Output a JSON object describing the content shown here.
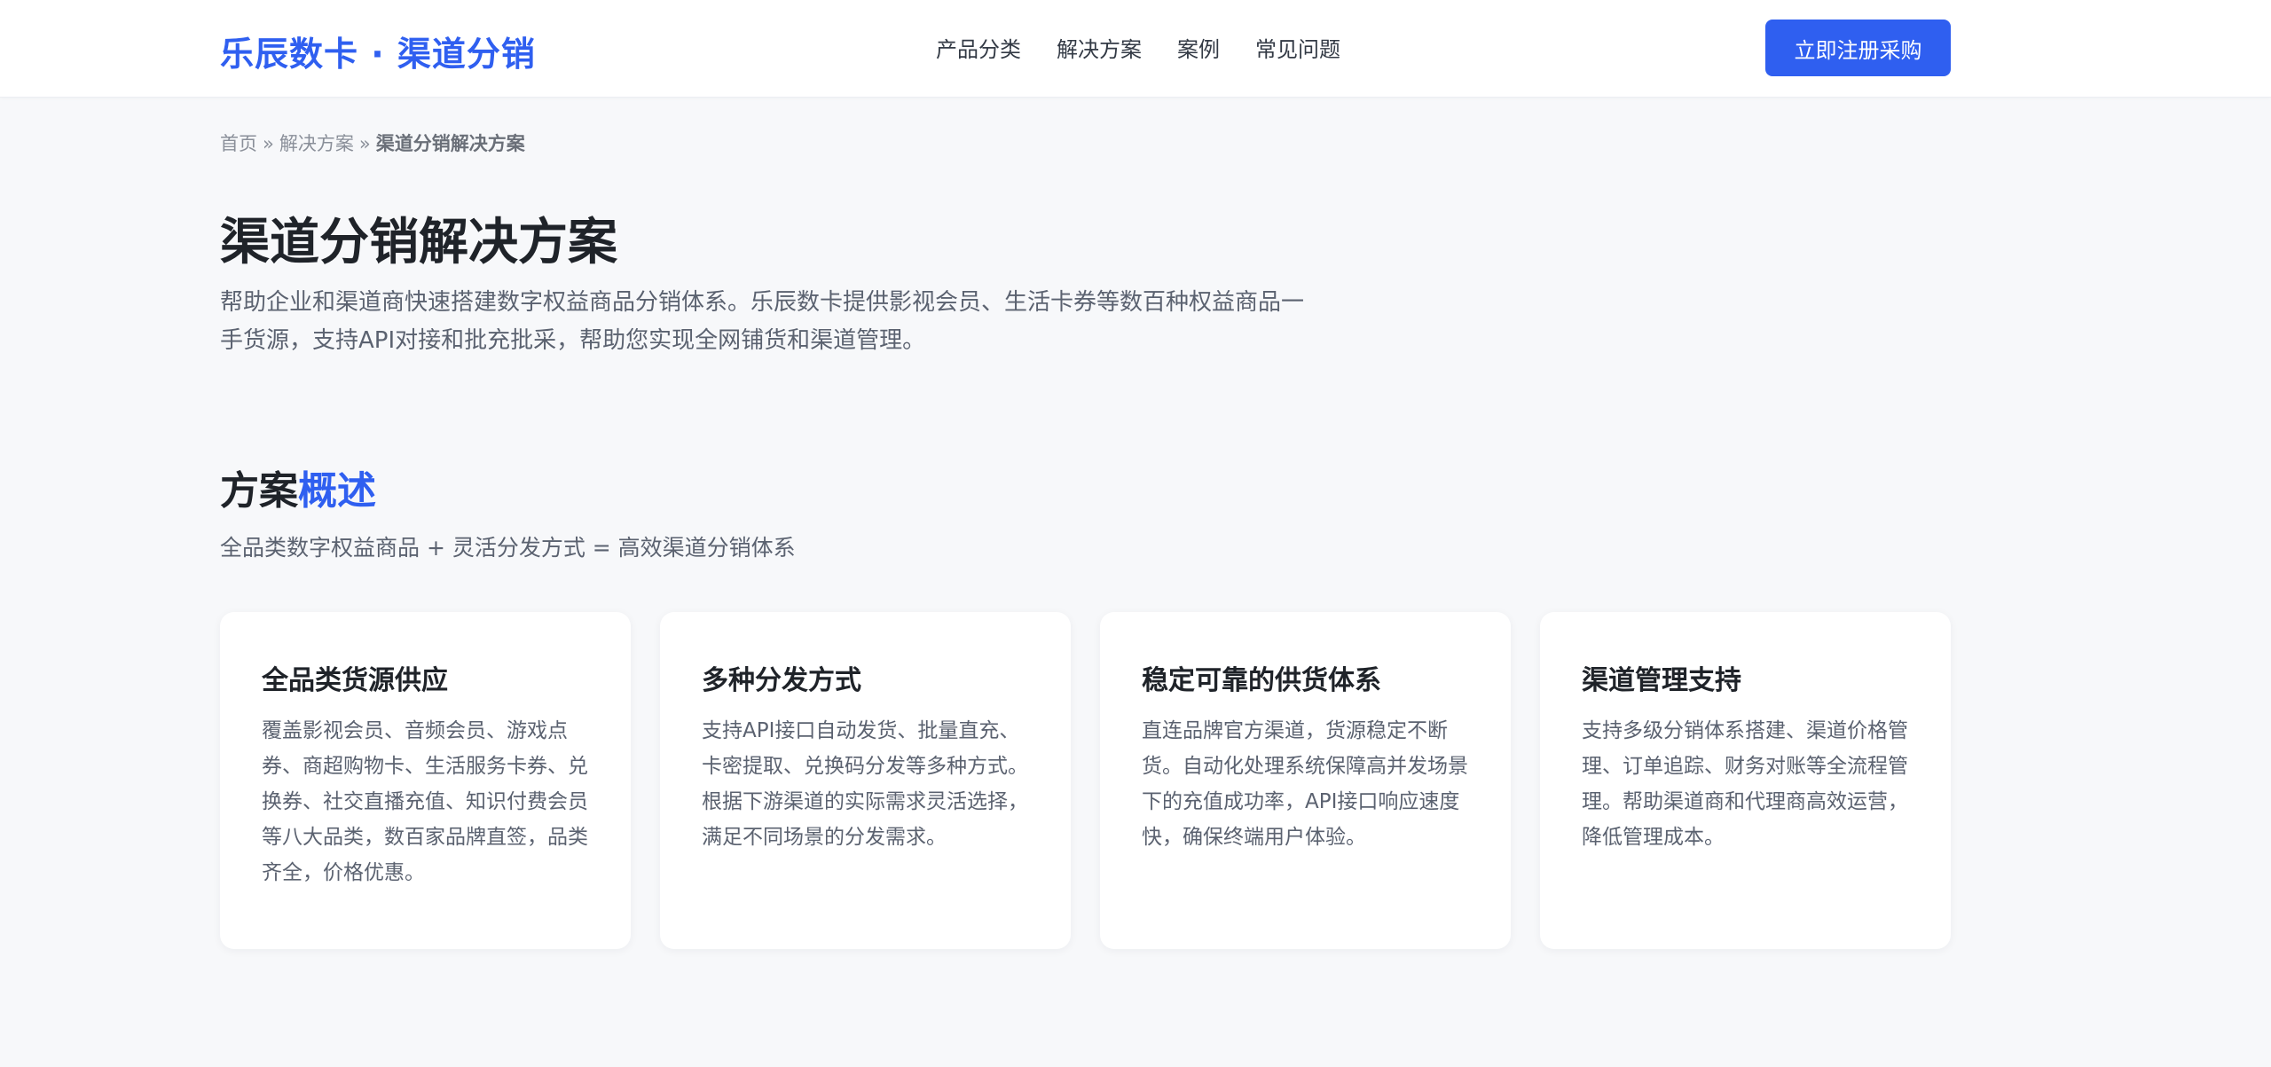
{
  "header": {
    "logo": "乐辰数卡 · 渠道分销",
    "nav": [
      "产品分类",
      "解决方案",
      "案例",
      "常见问题"
    ],
    "cta_label": "立即注册采购",
    "accent_color": "#2f5ff0"
  },
  "breadcrumb": {
    "items": [
      "首页",
      "解决方案"
    ],
    "separator": "»",
    "current": "渠道分销解决方案"
  },
  "hero": {
    "title": "渠道分销解决方案",
    "description": "帮助企业和渠道商快速搭建数字权益商品分销体系。乐辰数卡提供影视会员、生活卡券等数百种权益商品一手货源，支持API对接和批充批采，帮助您实现全网铺货和渠道管理。"
  },
  "overview": {
    "title_plain": "方案",
    "title_accent": "概述",
    "subtitle": "全品类数字权益商品 + 灵活分发方式 = 高效渠道分销体系",
    "cards": [
      {
        "title": "全品类货源供应",
        "body": "覆盖影视会员、音频会员、游戏点券、商超购物卡、生活服务卡券、兑换券、社交直播充值、知识付费会员等八大品类，数百家品牌直签，品类齐全，价格优惠。"
      },
      {
        "title": "多种分发方式",
        "body": "支持API接口自动发货、批量直充、卡密提取、兑换码分发等多种方式。根据下游渠道的实际需求灵活选择，满足不同场景的分发需求。"
      },
      {
        "title": "稳定可靠的供货体系",
        "body": "直连品牌官方渠道，货源稳定不断货。自动化处理系统保障高并发场景下的充值成功率，API接口响应速度快，确保终端用户体验。"
      },
      {
        "title": "渠道管理支持",
        "body": "支持多级分销体系搭建、渠道价格管理、订单追踪、财务对账等全流程管理。帮助渠道商和代理商高效运营，降低管理成本。"
      }
    ]
  }
}
